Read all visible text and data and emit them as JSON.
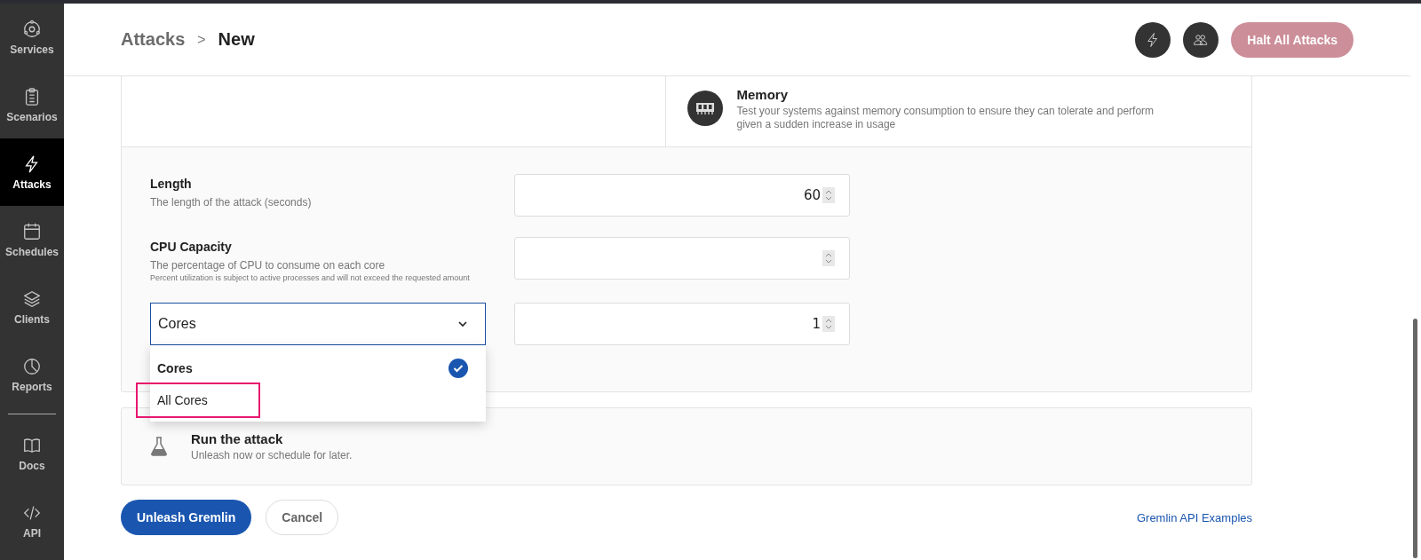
{
  "sidebar": {
    "items": [
      {
        "label": "Services",
        "kind": "services",
        "selected": false
      },
      {
        "label": "Scenarios",
        "kind": "clipboard",
        "selected": false
      },
      {
        "label": "Attacks",
        "kind": "bolt",
        "selected": true
      },
      {
        "label": "Schedules",
        "kind": "calendar",
        "selected": false
      },
      {
        "label": "Clients",
        "kind": "layers",
        "selected": false
      },
      {
        "label": "Reports",
        "kind": "pie",
        "selected": false
      }
    ],
    "bottom_items": [
      {
        "label": "Docs",
        "kind": "book",
        "selected": false
      },
      {
        "label": "API",
        "kind": "code",
        "selected": false
      }
    ]
  },
  "header": {
    "breadcrumb": [
      "Attacks",
      "New"
    ],
    "separator": ">",
    "halt_button": "Halt All Attacks"
  },
  "attack_type": {
    "title": "Memory",
    "description": "Test your systems against memory consumption to ensure they can tolerate and perform given a sudden increase in usage"
  },
  "fields": [
    {
      "label": "Length",
      "description": "The length of the attack (seconds)",
      "value": "60"
    },
    {
      "label": "CPU Capacity",
      "description": "The percentage of CPU to consume on each core",
      "note": "Percent utilization is subject to active processes and will not exceed the requested amount"
    }
  ],
  "core_select": {
    "value": "Cores",
    "count": "1",
    "expanded": true,
    "options": [
      {
        "label": "Cores",
        "selected": true,
        "highlighted": false
      },
      {
        "label": "All Cores",
        "selected": false,
        "highlighted": true
      }
    ]
  },
  "run_section": {
    "title": "Run the attack",
    "description": "Unleash now or schedule for later."
  },
  "actions": {
    "primary": "Unleash Gremlin",
    "secondary": "Cancel",
    "link": "Gremlin API Examples"
  }
}
